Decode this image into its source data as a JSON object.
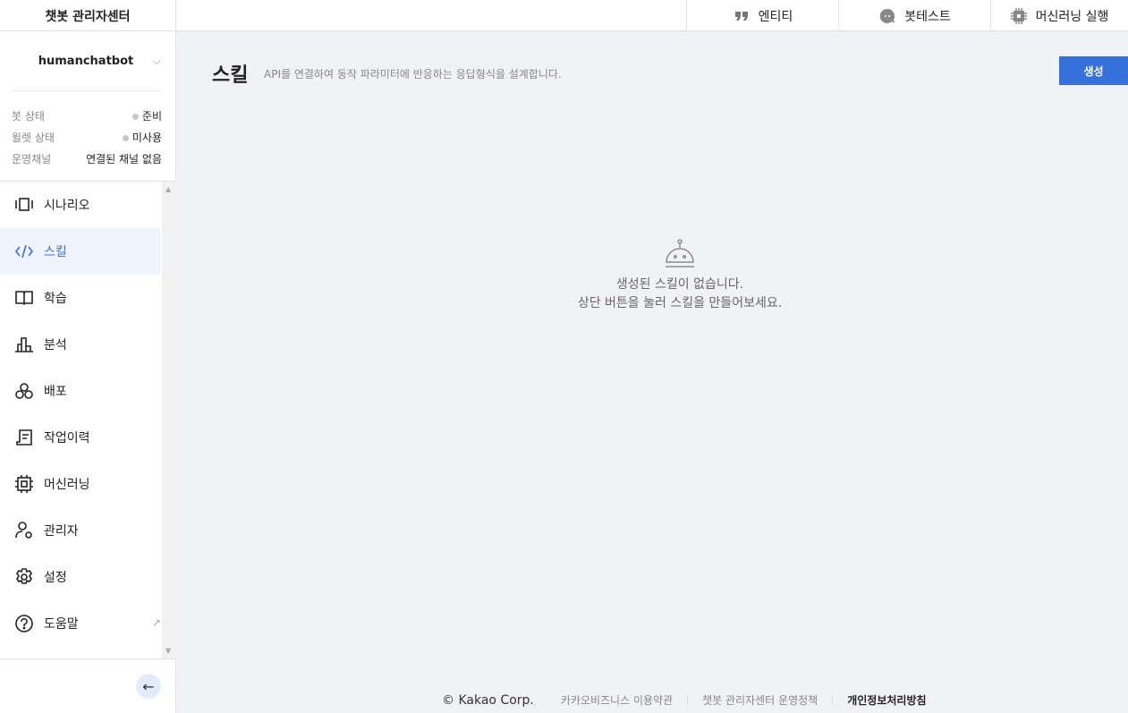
{
  "app": {
    "title": "챗봇 관리자센터"
  },
  "topnav": [
    {
      "label": "엔티티",
      "icon": "quote-icon"
    },
    {
      "label": "봇테스트",
      "icon": "chat-bubble-icon"
    },
    {
      "label": "머신러닝 실행",
      "icon": "chip-icon"
    }
  ],
  "bot": {
    "name": "humanchatbot",
    "status": [
      {
        "label": "봇 상태",
        "value": "준비",
        "dot": true
      },
      {
        "label": "윌렛 상태",
        "value": "미사용",
        "dot": true
      },
      {
        "label": "운영채널",
        "value": "연결된 채널 없음",
        "dot": false
      }
    ]
  },
  "sidebar": {
    "items": [
      {
        "label": "시나리오",
        "icon": "scenario-icon"
      },
      {
        "label": "스킬",
        "icon": "code-icon",
        "active": true
      },
      {
        "label": "학습",
        "icon": "book-icon"
      },
      {
        "label": "분석",
        "icon": "chart-icon"
      },
      {
        "label": "배포",
        "icon": "deploy-icon"
      },
      {
        "label": "작업이력",
        "icon": "history-icon"
      },
      {
        "label": "머신러닝",
        "icon": "chip-icon"
      },
      {
        "label": "관리자",
        "icon": "admin-icon"
      },
      {
        "label": "설정",
        "icon": "gear-icon"
      },
      {
        "label": "도움말",
        "icon": "help-icon",
        "external": true
      }
    ]
  },
  "page": {
    "title": "스킬",
    "description": "API를 연결하여 동작 파라미터에 반응하는 응답형식을 설계합니다.",
    "create_label": "생성",
    "empty_line1": "생성된 스킬이 없습니다.",
    "empty_line2": "상단 버튼을 눌러 스킬을 만들어보세요."
  },
  "footer": {
    "copyright": "© Kakao Corp.",
    "links": [
      "카카오비즈니스 이용약관",
      "챗봇 관리자센터 운영정책",
      "개인정보처리방침"
    ]
  },
  "colors": {
    "accent": "#3570db",
    "active_bg": "#eff4fd"
  }
}
